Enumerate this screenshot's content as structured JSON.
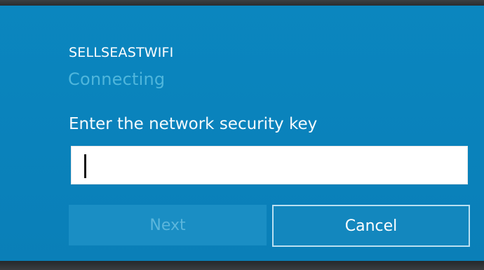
{
  "network": {
    "name": "SELLSEASTWIFI",
    "status": "Connecting"
  },
  "security_key": {
    "label": "Enter the network security key",
    "value": "",
    "placeholder": ""
  },
  "buttons": {
    "next_label": "Next",
    "cancel_label": "Cancel"
  },
  "colors": {
    "panel_background": "#0a83bc",
    "status_text": "#4fb6dc",
    "disabled_button_text": "#5bb6dc",
    "cancel_border": "#b9e0f1"
  }
}
